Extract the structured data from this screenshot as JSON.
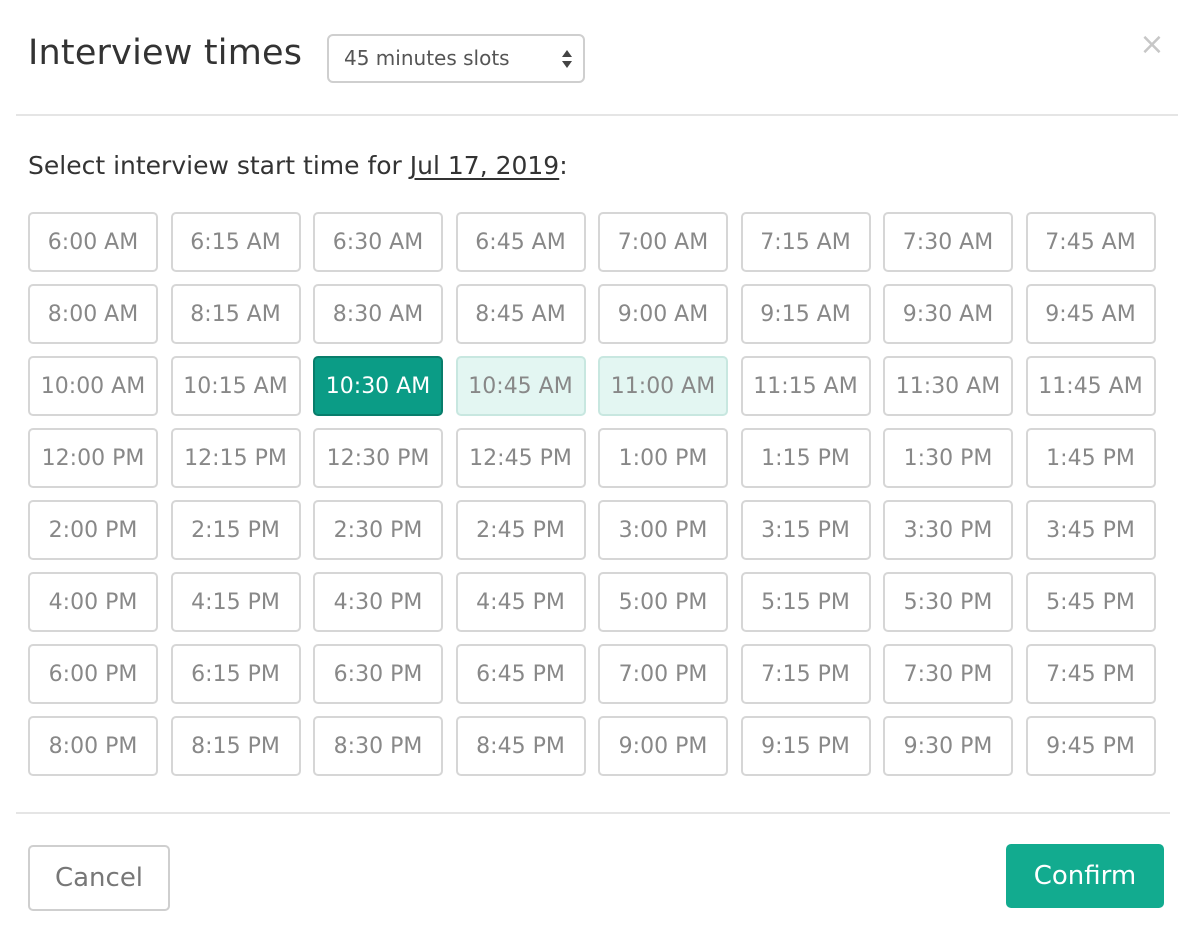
{
  "header": {
    "title": "Interview times",
    "slot_length": {
      "value": "45 minutes slots"
    },
    "close_glyph": "×"
  },
  "prompt": {
    "prefix": "Select interview start time for ",
    "date": "Jul 17, 2019",
    "suffix": ":"
  },
  "slots": [
    "6:00 AM",
    "6:15 AM",
    "6:30 AM",
    "6:45 AM",
    "7:00 AM",
    "7:15 AM",
    "7:30 AM",
    "7:45 AM",
    "8:00 AM",
    "8:15 AM",
    "8:30 AM",
    "8:45 AM",
    "9:00 AM",
    "9:15 AM",
    "9:30 AM",
    "9:45 AM",
    "10:00 AM",
    "10:15 AM",
    "10:30 AM",
    "10:45 AM",
    "11:00 AM",
    "11:15 AM",
    "11:30 AM",
    "11:45 AM",
    "12:00 PM",
    "12:15 PM",
    "12:30 PM",
    "12:45 PM",
    "1:00 PM",
    "1:15 PM",
    "1:30 PM",
    "1:45 PM",
    "2:00 PM",
    "2:15 PM",
    "2:30 PM",
    "2:45 PM",
    "3:00 PM",
    "3:15 PM",
    "3:30 PM",
    "3:45 PM",
    "4:00 PM",
    "4:15 PM",
    "4:30 PM",
    "4:45 PM",
    "5:00 PM",
    "5:15 PM",
    "5:30 PM",
    "5:45 PM",
    "6:00 PM",
    "6:15 PM",
    "6:30 PM",
    "6:45 PM",
    "7:00 PM",
    "7:15 PM",
    "7:30 PM",
    "7:45 PM",
    "8:00 PM",
    "8:15 PM",
    "8:30 PM",
    "8:45 PM",
    "9:00 PM",
    "9:15 PM",
    "9:30 PM",
    "9:45 PM"
  ],
  "selected_slot": "10:30 AM",
  "in_range_slots": [
    "10:45 AM",
    "11:00 AM"
  ],
  "footer": {
    "cancel_label": "Cancel",
    "confirm_label": "Confirm"
  },
  "colors": {
    "accent": "#12ab8f",
    "selected": "#0b9c86",
    "range_highlight": "#e3f6f2"
  }
}
